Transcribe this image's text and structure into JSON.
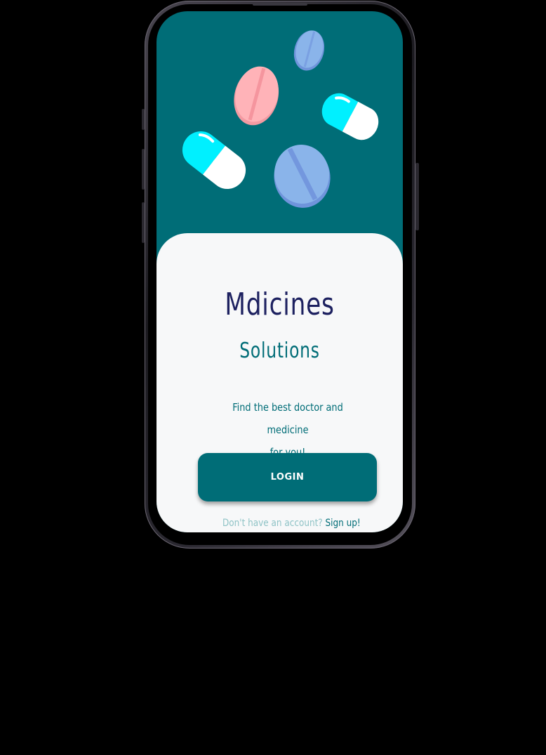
{
  "app": {
    "title": "Mdicines",
    "subtitle": "Solutions",
    "tagline_line1": "Find the best doctor and medicine",
    "tagline_line2": "for you!"
  },
  "actions": {
    "login_label": "LOGIN",
    "signup_prompt": "Don't have an account?",
    "signup_link": "Sign up!"
  },
  "colors": {
    "primary": "#006d77",
    "title": "#1d2160",
    "card": "#f7f8f9",
    "pill_pink": "#ffb3b8",
    "pill_blue": "#8ab4ea",
    "pill_cyan": "#00f0ff",
    "muted_text": "#8fc3c6"
  },
  "icons": {
    "pills": [
      "blue-tablet-small",
      "pink-tablet",
      "cyan-capsule-right",
      "cyan-capsule-left",
      "blue-tablet-large"
    ]
  }
}
